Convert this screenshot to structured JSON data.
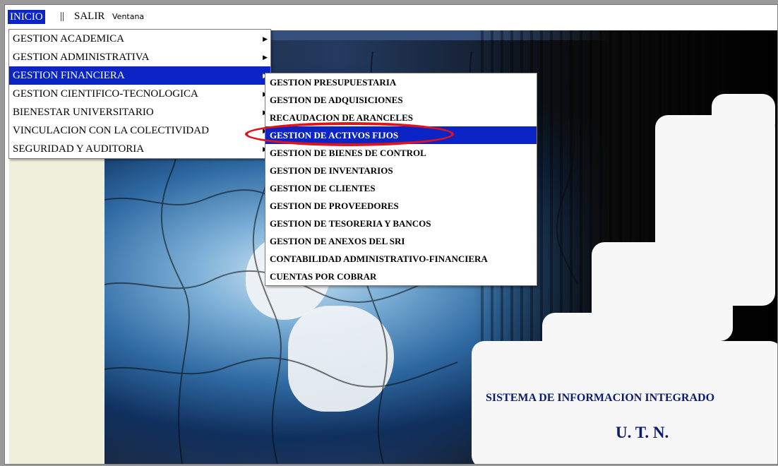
{
  "menubar": {
    "inicio": "INICIO",
    "separator": "||",
    "salir": "SALIR",
    "ventana": "Ventana"
  },
  "main_menu": {
    "items": [
      {
        "label": "GESTION ACADEMICA"
      },
      {
        "label": "GESTION ADMINISTRATIVA"
      },
      {
        "label": "GESTION FINANCIERA"
      },
      {
        "label": "GESTION CIENTIFICO-TECNOLOGICA"
      },
      {
        "label": "BIENESTAR UNIVERSITARIO"
      },
      {
        "label": "VINCULACION CON LA COLECTIVIDAD"
      },
      {
        "label": "SEGURIDAD Y AUDITORIA"
      }
    ],
    "selected_index": 2
  },
  "submenu": {
    "items": [
      {
        "label": "GESTION PRESUPUESTARIA"
      },
      {
        "label": "GESTION DE ADQUISICIONES"
      },
      {
        "label": "RECAUDACION DE ARANCELES"
      },
      {
        "label": "GESTION DE ACTIVOS FIJOS"
      },
      {
        "label": "GESTION DE BIENES DE CONTROL"
      },
      {
        "label": "GESTION DE INVENTARIOS"
      },
      {
        "label": "GESTION DE CLIENTES"
      },
      {
        "label": "GESTION DE PROVEEDORES"
      },
      {
        "label": "GESTION DE TESORERIA Y BANCOS"
      },
      {
        "label": "GESTION DE ANEXOS DEL SRI"
      },
      {
        "label": "CONTABILIDAD ADMINISTRATIVO-FINANCIERA"
      },
      {
        "label": "CUENTAS POR COBRAR"
      }
    ],
    "selected_index": 3
  },
  "background": {
    "title": "SISTEMA DE INFORMACION INTEGRADO",
    "subtitle": "U. T. N."
  },
  "colors": {
    "selection": "#0a24c6",
    "title_text": "#0c1b72",
    "annotation": "#e0121a"
  }
}
